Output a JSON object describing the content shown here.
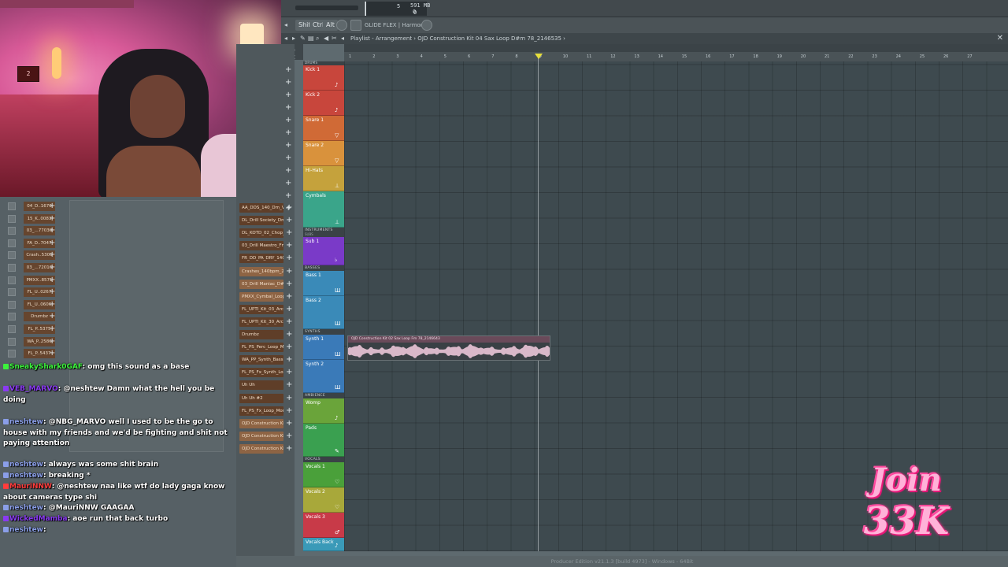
{
  "toolbar": {
    "readout_a": "5",
    "readout_b": "0",
    "memory": "591 MB",
    "memory_b": "0",
    "mods": [
      "Shift",
      "Ctrl",
      "Alt"
    ],
    "flex_label": "GLIDE FLEX | Harmony"
  },
  "playlist": {
    "breadcrumb": "Playlist - Arrangement  ›  OJD Construction Kit 04 Sax Loop D#m 78_2146535  ›",
    "ruler": [
      "1",
      "2",
      "3",
      "4",
      "5",
      "6",
      "7",
      "8",
      "9",
      "10",
      "11",
      "12",
      "13",
      "14",
      "15",
      "16",
      "17",
      "18",
      "19",
      "20",
      "21",
      "22",
      "23",
      "24",
      "25",
      "26",
      "27"
    ],
    "clip_title": "OJD Construction Kit 02 Sax Loop Fm 78_2146643",
    "groups": {
      "drums": "DRUMS",
      "instruments": "INSTRUMENTS",
      "subs": "SUBS",
      "basses": "BASSES",
      "synths": "SYNTHS",
      "ambience": "AMBIENCE",
      "vocals": "VOCALS"
    },
    "tracks": [
      "Kick 1",
      "Kick 2",
      "Snare 1",
      "Snare 2",
      "Hi-Hats",
      "Cymbals",
      "Sub 1",
      "Bass 1",
      "Bass 2",
      "Synth 1",
      "Synth 2",
      "Womp",
      "Pads",
      "Vocals 1",
      "Vocals 2",
      "Vocals 3",
      "Vocals Back"
    ]
  },
  "channels": [
    "AA_DDS_140_Dm_VR...",
    "DL_Drill Society_Dm...",
    "DL_KOTD_02_Chop_D...",
    "03_Drill Maestro_Fmi...",
    "FR_DD_PA_DRY_140...",
    "Crashes_140bpm_22...",
    "03_Drill Maniac_D#m...",
    "PMXX_Cymbal_Loop...",
    "FL_UPTI_Kit_03_Arc...",
    "FL_UPTI_Kit_30_Arc...",
    "Drumbz",
    "FL_PS_Perc_Loop_M...",
    "WA_PP_Synth_Bass...",
    "FL_PS_Fx_Synth_Loop...",
    "Uh Uh",
    "Uh Uh #2",
    "FL_PS_Fx_Loop_Mor...",
    "OJD Construction Kit...",
    "OJD Construction Kit...",
    "OJD Construction Kit..."
  ],
  "browser": [
    "04_D..1670",
    "15_K..0083",
    "03_...77030",
    "FA_D..7047",
    "Crash..5305",
    "03_...72016",
    "PMXX..8571",
    "FL_U..0267",
    "FL_U..0606",
    "Drumbz",
    "FL_P..5375",
    "WA_P..2586",
    "FL_P..5437"
  ],
  "chat": [
    {
      "user": "SneakyShark0GAF",
      "color": "#3cf23c",
      "text": ": omg this sound as a base"
    },
    {
      "user": "VEB_MARVO",
      "color": "#8a3af2",
      "text": ": @neshtew Damn what the hell you be doing"
    },
    {
      "user": "neshtew",
      "color": "#8a9ee8",
      "text": ": @NBG_MARVO well I used to be the go to house with my friends and we'd be fighting and shit not paying attention"
    },
    {
      "user": "neshtew",
      "color": "#8a9ee8",
      "text": ": always was some shit brain"
    },
    {
      "user": "neshtew",
      "color": "#8a9ee8",
      "text": ": breaking *"
    },
    {
      "user": "MauriNNW",
      "color": "#ff3c3c",
      "text": ": @neshtew naa like wtf do lady gaga know about cameras type shi"
    },
    {
      "user": "neshtew",
      "color": "#8a9ee8",
      "text": ": @MauriNNW GAAGAA"
    },
    {
      "user": "WickedMamba",
      "color": "#8a3af2",
      "text": ": aoe run that back turbo"
    },
    {
      "user": "neshtew",
      "color": "#8a9ee8",
      "text": ":"
    }
  ],
  "status": "Producer Edition v21.1.3 [build 4973] - Windows - 64Bit",
  "webcam": {
    "clock": "2"
  },
  "promo": {
    "line1": "Join",
    "line2": "33K"
  }
}
